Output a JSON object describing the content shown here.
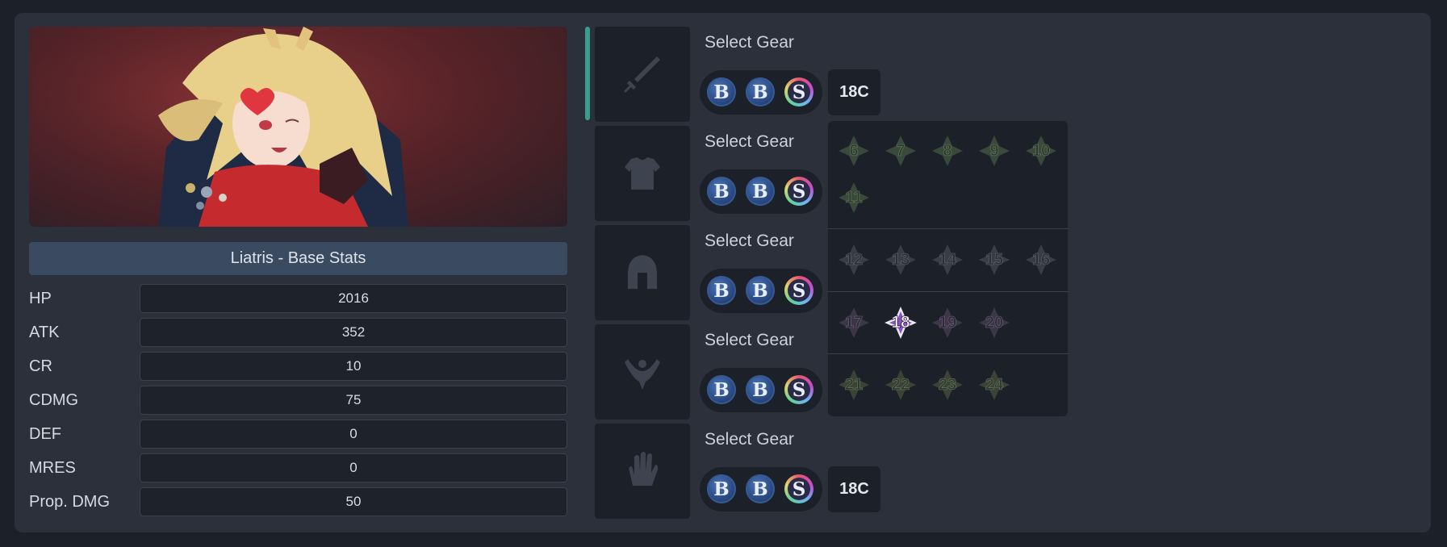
{
  "character": {
    "header": "Liatris - Base Stats",
    "portrait_icon": "character-portrait"
  },
  "stats": [
    {
      "label": "HP",
      "value": "2016"
    },
    {
      "label": "ATK",
      "value": "352"
    },
    {
      "label": "CR",
      "value": "10"
    },
    {
      "label": "CDMG",
      "value": "75"
    },
    {
      "label": "DEF",
      "value": "0"
    },
    {
      "label": "MRES",
      "value": "0"
    },
    {
      "label": "Prop. DMG",
      "value": "50"
    }
  ],
  "gear": [
    {
      "slot": "weapon",
      "icon": "sword-icon",
      "title": "Select Gear",
      "coins": [
        "B",
        "B",
        "S"
      ],
      "level": "18C"
    },
    {
      "slot": "armor",
      "icon": "armor-icon",
      "title": "Select Gear",
      "coins": [
        "B",
        "B",
        "S"
      ]
    },
    {
      "slot": "helmet",
      "icon": "helmet-icon",
      "title": "Select Gear",
      "coins": [
        "B",
        "B",
        "S"
      ]
    },
    {
      "slot": "necklace",
      "icon": "necklace-icon",
      "title": "Select Gear",
      "coins": [
        "B",
        "B",
        "S"
      ]
    },
    {
      "slot": "gloves",
      "icon": "glove-icon",
      "title": "Select Gear",
      "coins": [
        "B",
        "B",
        "S"
      ],
      "level": "18C"
    }
  ],
  "level_dropdown": {
    "groups": [
      [
        "6",
        "7",
        "8",
        "9",
        "10",
        "11"
      ],
      [
        "12",
        "13",
        "14",
        "15",
        "16"
      ],
      [
        "17",
        "18",
        "19",
        "20"
      ],
      [
        "21",
        "22",
        "23",
        "24"
      ]
    ],
    "selected": "18"
  },
  "colors": {
    "accent": "#3a9c8d",
    "panel": "#2b303b",
    "background": "#1c2129"
  }
}
